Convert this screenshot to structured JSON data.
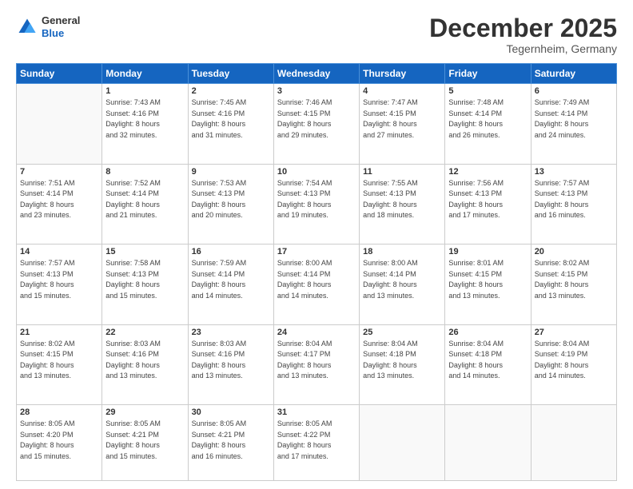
{
  "header": {
    "logo_general": "General",
    "logo_blue": "Blue",
    "month_title": "December 2025",
    "location": "Tegernheim, Germany"
  },
  "days_of_week": [
    "Sunday",
    "Monday",
    "Tuesday",
    "Wednesday",
    "Thursday",
    "Friday",
    "Saturday"
  ],
  "weeks": [
    [
      {
        "day": "",
        "sunrise": "",
        "sunset": "",
        "daylight": ""
      },
      {
        "day": "1",
        "sunrise": "Sunrise: 7:43 AM",
        "sunset": "Sunset: 4:16 PM",
        "daylight": "Daylight: 8 hours and 32 minutes."
      },
      {
        "day": "2",
        "sunrise": "Sunrise: 7:45 AM",
        "sunset": "Sunset: 4:16 PM",
        "daylight": "Daylight: 8 hours and 31 minutes."
      },
      {
        "day": "3",
        "sunrise": "Sunrise: 7:46 AM",
        "sunset": "Sunset: 4:15 PM",
        "daylight": "Daylight: 8 hours and 29 minutes."
      },
      {
        "day": "4",
        "sunrise": "Sunrise: 7:47 AM",
        "sunset": "Sunset: 4:15 PM",
        "daylight": "Daylight: 8 hours and 27 minutes."
      },
      {
        "day": "5",
        "sunrise": "Sunrise: 7:48 AM",
        "sunset": "Sunset: 4:14 PM",
        "daylight": "Daylight: 8 hours and 26 minutes."
      },
      {
        "day": "6",
        "sunrise": "Sunrise: 7:49 AM",
        "sunset": "Sunset: 4:14 PM",
        "daylight": "Daylight: 8 hours and 24 minutes."
      }
    ],
    [
      {
        "day": "7",
        "sunrise": "Sunrise: 7:51 AM",
        "sunset": "Sunset: 4:14 PM",
        "daylight": "Daylight: 8 hours and 23 minutes."
      },
      {
        "day": "8",
        "sunrise": "Sunrise: 7:52 AM",
        "sunset": "Sunset: 4:14 PM",
        "daylight": "Daylight: 8 hours and 21 minutes."
      },
      {
        "day": "9",
        "sunrise": "Sunrise: 7:53 AM",
        "sunset": "Sunset: 4:13 PM",
        "daylight": "Daylight: 8 hours and 20 minutes."
      },
      {
        "day": "10",
        "sunrise": "Sunrise: 7:54 AM",
        "sunset": "Sunset: 4:13 PM",
        "daylight": "Daylight: 8 hours and 19 minutes."
      },
      {
        "day": "11",
        "sunrise": "Sunrise: 7:55 AM",
        "sunset": "Sunset: 4:13 PM",
        "daylight": "Daylight: 8 hours and 18 minutes."
      },
      {
        "day": "12",
        "sunrise": "Sunrise: 7:56 AM",
        "sunset": "Sunset: 4:13 PM",
        "daylight": "Daylight: 8 hours and 17 minutes."
      },
      {
        "day": "13",
        "sunrise": "Sunrise: 7:57 AM",
        "sunset": "Sunset: 4:13 PM",
        "daylight": "Daylight: 8 hours and 16 minutes."
      }
    ],
    [
      {
        "day": "14",
        "sunrise": "Sunrise: 7:57 AM",
        "sunset": "Sunset: 4:13 PM",
        "daylight": "Daylight: 8 hours and 15 minutes."
      },
      {
        "day": "15",
        "sunrise": "Sunrise: 7:58 AM",
        "sunset": "Sunset: 4:13 PM",
        "daylight": "Daylight: 8 hours and 15 minutes."
      },
      {
        "day": "16",
        "sunrise": "Sunrise: 7:59 AM",
        "sunset": "Sunset: 4:14 PM",
        "daylight": "Daylight: 8 hours and 14 minutes."
      },
      {
        "day": "17",
        "sunrise": "Sunrise: 8:00 AM",
        "sunset": "Sunset: 4:14 PM",
        "daylight": "Daylight: 8 hours and 14 minutes."
      },
      {
        "day": "18",
        "sunrise": "Sunrise: 8:00 AM",
        "sunset": "Sunset: 4:14 PM",
        "daylight": "Daylight: 8 hours and 13 minutes."
      },
      {
        "day": "19",
        "sunrise": "Sunrise: 8:01 AM",
        "sunset": "Sunset: 4:15 PM",
        "daylight": "Daylight: 8 hours and 13 minutes."
      },
      {
        "day": "20",
        "sunrise": "Sunrise: 8:02 AM",
        "sunset": "Sunset: 4:15 PM",
        "daylight": "Daylight: 8 hours and 13 minutes."
      }
    ],
    [
      {
        "day": "21",
        "sunrise": "Sunrise: 8:02 AM",
        "sunset": "Sunset: 4:15 PM",
        "daylight": "Daylight: 8 hours and 13 minutes."
      },
      {
        "day": "22",
        "sunrise": "Sunrise: 8:03 AM",
        "sunset": "Sunset: 4:16 PM",
        "daylight": "Daylight: 8 hours and 13 minutes."
      },
      {
        "day": "23",
        "sunrise": "Sunrise: 8:03 AM",
        "sunset": "Sunset: 4:16 PM",
        "daylight": "Daylight: 8 hours and 13 minutes."
      },
      {
        "day": "24",
        "sunrise": "Sunrise: 8:04 AM",
        "sunset": "Sunset: 4:17 PM",
        "daylight": "Daylight: 8 hours and 13 minutes."
      },
      {
        "day": "25",
        "sunrise": "Sunrise: 8:04 AM",
        "sunset": "Sunset: 4:18 PM",
        "daylight": "Daylight: 8 hours and 13 minutes."
      },
      {
        "day": "26",
        "sunrise": "Sunrise: 8:04 AM",
        "sunset": "Sunset: 4:18 PM",
        "daylight": "Daylight: 8 hours and 14 minutes."
      },
      {
        "day": "27",
        "sunrise": "Sunrise: 8:04 AM",
        "sunset": "Sunset: 4:19 PM",
        "daylight": "Daylight: 8 hours and 14 minutes."
      }
    ],
    [
      {
        "day": "28",
        "sunrise": "Sunrise: 8:05 AM",
        "sunset": "Sunset: 4:20 PM",
        "daylight": "Daylight: 8 hours and 15 minutes."
      },
      {
        "day": "29",
        "sunrise": "Sunrise: 8:05 AM",
        "sunset": "Sunset: 4:21 PM",
        "daylight": "Daylight: 8 hours and 15 minutes."
      },
      {
        "day": "30",
        "sunrise": "Sunrise: 8:05 AM",
        "sunset": "Sunset: 4:21 PM",
        "daylight": "Daylight: 8 hours and 16 minutes."
      },
      {
        "day": "31",
        "sunrise": "Sunrise: 8:05 AM",
        "sunset": "Sunset: 4:22 PM",
        "daylight": "Daylight: 8 hours and 17 minutes."
      },
      {
        "day": "",
        "sunrise": "",
        "sunset": "",
        "daylight": ""
      },
      {
        "day": "",
        "sunrise": "",
        "sunset": "",
        "daylight": ""
      },
      {
        "day": "",
        "sunrise": "",
        "sunset": "",
        "daylight": ""
      }
    ]
  ]
}
